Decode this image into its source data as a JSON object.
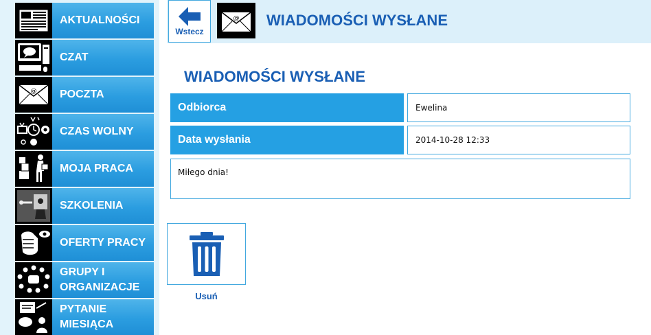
{
  "sidebar": {
    "items": [
      {
        "label": "AKTUALNOŚCI",
        "icon": "newspaper-icon"
      },
      {
        "label": "CZAT",
        "icon": "computer-chat-icon"
      },
      {
        "label": "POCZTA",
        "icon": "envelope-icon"
      },
      {
        "label": "CZAS WOLNY",
        "icon": "leisure-icon"
      },
      {
        "label": "MOJA PRACA",
        "icon": "worker-boxes-icon"
      },
      {
        "label": "SZKOLENIA",
        "icon": "presentation-icon"
      },
      {
        "label": "OFERTY PRACY",
        "icon": "hand-eye-icon"
      },
      {
        "label": "GRUPY I\nORGANIZACJE",
        "icon": "group-circle-icon"
      },
      {
        "label": "PYTANIE\nMIESIĄCA",
        "icon": "question-board-icon"
      }
    ]
  },
  "header": {
    "back_label": "Wstecz",
    "title": "WIADOMOŚCI WYSŁANE"
  },
  "main": {
    "section_title": "WIADOMOŚCI WYSŁANE",
    "fields": [
      {
        "label": "Odbiorca",
        "value": "Ewelina"
      },
      {
        "label": "Data wysłania",
        "value": "2014-10-28 12:33"
      }
    ],
    "message": "Miłego dnia!",
    "delete_label": "Usuń"
  },
  "colors": {
    "accent_blue": "#25a0e3",
    "title_blue": "#1a5fb4",
    "sidebar_bg": "#e2f3fb",
    "topbar_bg": "#dcf0fa"
  }
}
